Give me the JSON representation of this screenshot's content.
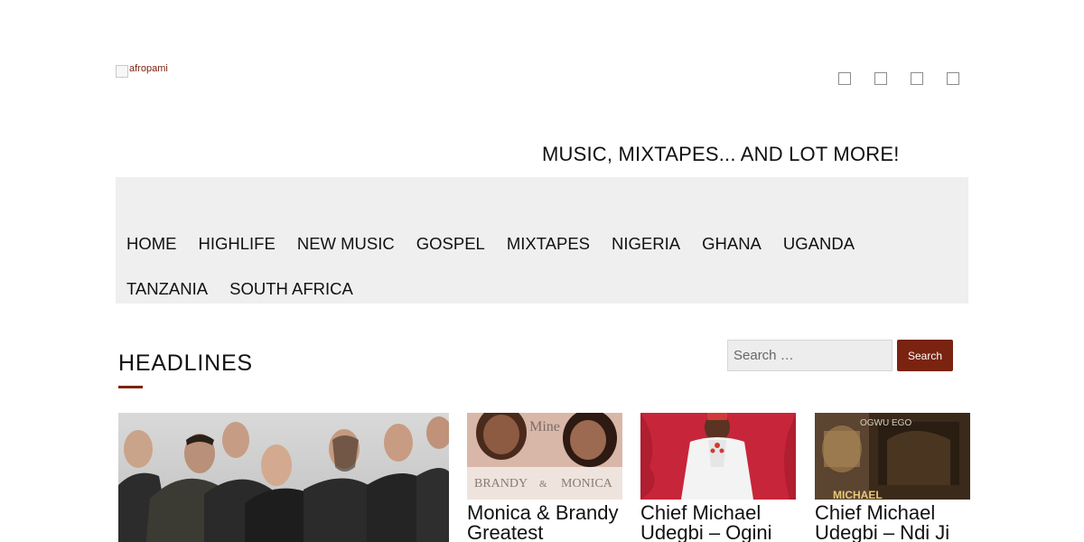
{
  "header": {
    "logo_alt": "afropami",
    "tagline": "MUSIC, MIXTAPES... AND LOT MORE!",
    "social_icons": [
      "social-icon-1",
      "social-icon-2",
      "social-icon-3",
      "social-icon-4"
    ]
  },
  "nav": {
    "items": [
      {
        "label": "HOME"
      },
      {
        "label": "HIGHLIFE"
      },
      {
        "label": "NEW MUSIC"
      },
      {
        "label": "GOSPEL"
      },
      {
        "label": "MIXTAPES"
      },
      {
        "label": "NIGERIA"
      },
      {
        "label": "GHANA"
      },
      {
        "label": "UGANDA"
      },
      {
        "label": "TANZANIA"
      },
      {
        "label": "SOUTH AFRICA"
      }
    ]
  },
  "search": {
    "placeholder": "Search …",
    "button_label": "Search"
  },
  "headlines": {
    "title": "HEADLINES",
    "cards": [
      {
        "title": "Monica & Brandy Greatest"
      },
      {
        "title": "Chief Michael Udegbi – Ogini"
      },
      {
        "title": "Chief Michael Udegbi – Ndi Ji"
      }
    ],
    "artwork_text": {
      "brandy": "BRANDY",
      "amp": "&",
      "monica": "MONICA",
      "mine": "Mine",
      "ogwu_ego": "OGWU EGO",
      "michael": "MICHAEL"
    }
  },
  "colors": {
    "accent": "#7a2310",
    "nav_bg": "#efefef"
  }
}
